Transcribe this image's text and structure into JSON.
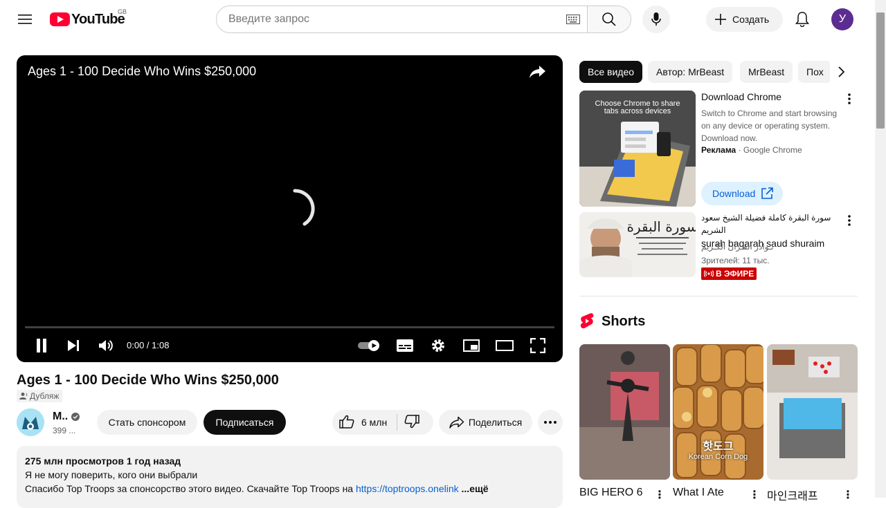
{
  "header": {
    "logo_text": "YouTube",
    "country_code": "GB",
    "search_placeholder": "Введите запрос",
    "create_label": "Создать",
    "avatar_letter": "У"
  },
  "player": {
    "overlay_title": "Ages 1 - 100 Decide Who Wins $250,000",
    "time": "0:00 / 1:08"
  },
  "video": {
    "title": "Ages 1 - 100 Decide Who Wins $250,000",
    "dub_label": "Дубляж",
    "channel_name": "M..",
    "channel_subs": "399 ...",
    "sponsor_label": "Стать спонсором",
    "subscribe_label": "Подписаться",
    "likes": "6 млн",
    "share_label": "Поделиться"
  },
  "description": {
    "meta": "275 млн просмотров  1 год назад",
    "line1": "Я не могу поверить, кого они выбрали",
    "line2_prefix": "Спасибо Top Troops за спонсорство этого видео. Скачайте Top Troops на ",
    "link": "https://toptroops.onelink",
    "more": "...ещё"
  },
  "chips": [
    "Все видео",
    "Автор: MrBeast",
    "MrBeast",
    "Пох"
  ],
  "ad": {
    "title": "Download Chrome",
    "description": "Switch to Chrome and start browsing on any device or operating system. Download now.",
    "label": "Реклама",
    "advertiser": "Google Chrome",
    "button": "Download",
    "thumb_text": "Choose Chrome to share tabs across devices"
  },
  "related": {
    "title": "سورة البقرة كاملة فضيلة الشيخ سعود الشريم surah baqarah saud shuraim",
    "title_ar": "سورة البقرة كاملة فضيلة الشيخ سعود الشريم",
    "title_en": "surah baqarah saud shuraim",
    "channel": "نـوادر القـرآن الكـريم",
    "views": "Зрителей: 11 тыс.",
    "live_label": "В ЭФИРЕ"
  },
  "shorts": {
    "header": "Shorts",
    "items": [
      {
        "title": "BIG HERO 6"
      },
      {
        "title": "What I Ate",
        "overlay_ko": "핫도그",
        "overlay_en": "Korean Corn Dog"
      },
      {
        "title": "마인크래프"
      }
    ]
  },
  "colors": {
    "brand_red": "#ff0033",
    "link_blue": "#065fd4",
    "live_red": "#cc0000"
  }
}
